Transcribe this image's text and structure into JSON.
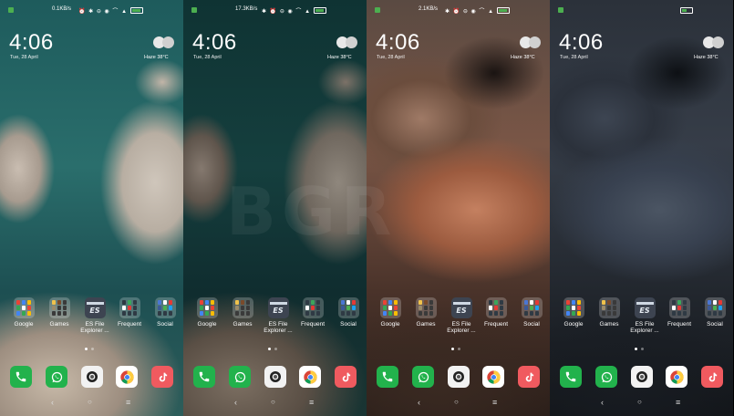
{
  "screens": [
    {
      "theme": "original",
      "status": {
        "speed": "0.1KB/s",
        "icons": "⏰ ✱ ⊖ ◉ ⌒ ▲",
        "battery_pct": 0.85
      },
      "clock": "4:06",
      "date": "Tue, 28 April",
      "weather": {
        "text": "Haze 38°C",
        "icon": "cloud-icon"
      }
    },
    {
      "theme": "dimmed",
      "status": {
        "speed": "17.3KB/s",
        "icons": "✱ ⏰ ⊖ ◉ ⌒ ▲",
        "battery_pct": 0.85
      },
      "clock": "4:06",
      "date": "Tue, 28 April",
      "weather": {
        "text": "Haze 38°C",
        "icon": "cloud-icon"
      }
    },
    {
      "theme": "dark-rust",
      "status": {
        "speed": "2.1KB/s",
        "icons": "✱ ⏰ ⊖ ◉ ⌒ ▲",
        "battery_pct": 0.85
      },
      "clock": "4:06",
      "date": "Tue, 28 April",
      "weather": {
        "text": "Haze 38°C",
        "icon": "cloud-icon"
      }
    },
    {
      "theme": "dark-slate",
      "status": {
        "speed": "",
        "icons": "",
        "battery_pct": 0.5
      },
      "clock": "4:06",
      "date": "Tue, 28 April",
      "weather": {
        "text": "Haze 38°C",
        "icon": "cloud-icon"
      }
    }
  ],
  "apps": [
    {
      "label": "Google",
      "label2": "",
      "type": "folder",
      "icon": "google-folder-icon",
      "colors": [
        "#ea4335",
        "#4285f4",
        "#fbbc05",
        "#34a853",
        "#ffffff",
        "#ea4335",
        "#4285f4",
        "#34a853",
        "#fbbc05"
      ]
    },
    {
      "label": "Games",
      "label2": "",
      "type": "folder",
      "icon": "games-folder-icon",
      "colors": [
        "#f0c24b",
        "#7a4a2a",
        "#3a3a3a",
        "#9a8a6a",
        "#3a3a3a",
        "#3a3a3a",
        "#3a3a3a",
        "#3a3a3a",
        "#3a3a3a"
      ]
    },
    {
      "label": "ES File",
      "label2": "Explorer ...",
      "type": "es",
      "icon": "es-file-explorer-icon",
      "mark": "ES"
    },
    {
      "label": "Frequent",
      "label2": "",
      "type": "folder",
      "icon": "frequent-folder-icon",
      "colors": [
        "#2f3a44",
        "#3ba55c",
        "#2f3a44",
        "#ffffff",
        "#e53935",
        "#2f3a44",
        "#2f3a44",
        "#2f3a44",
        "#2f3a44"
      ]
    },
    {
      "label": "Social",
      "label2": "",
      "type": "folder",
      "icon": "social-folder-icon",
      "colors": [
        "#4a76d4",
        "#ffffff",
        "#e53935",
        "#3b5998",
        "#4caf50",
        "#1da1f2",
        "#2f3a44",
        "#2f3a44",
        "#2f3a44"
      ]
    }
  ],
  "dock": [
    {
      "name": "phone",
      "icon": "phone-icon"
    },
    {
      "name": "whatsapp",
      "icon": "whatsapp-icon"
    },
    {
      "name": "camera",
      "icon": "camera-icon"
    },
    {
      "name": "chrome",
      "icon": "chrome-icon"
    },
    {
      "name": "tiktok",
      "icon": "tiktok-icon"
    }
  ],
  "nav": {
    "back": "‹",
    "home": "○",
    "recents": "≡"
  },
  "page_indicator": {
    "pages": 2,
    "current": 1
  },
  "watermark": "BGR"
}
